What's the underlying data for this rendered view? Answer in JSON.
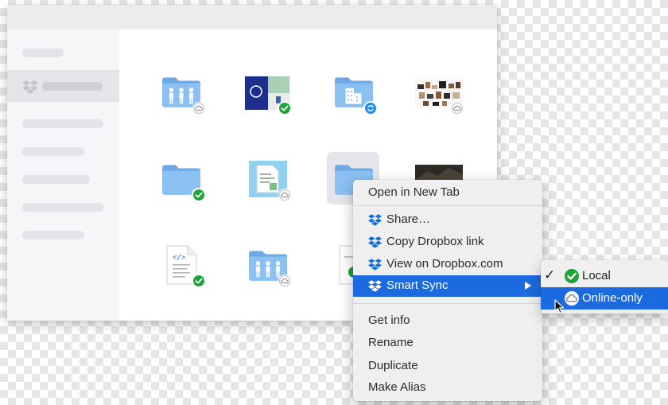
{
  "window": {
    "sidebar_items": 7,
    "selected_item": "dropbox"
  },
  "files": [
    {
      "name": "shared-folder",
      "status": "online-only"
    },
    {
      "name": "image-file",
      "status": "synced"
    },
    {
      "name": "building-folder",
      "status": "syncing"
    },
    {
      "name": "collage-image",
      "status": "online-only"
    },
    {
      "name": "folder",
      "status": "synced"
    },
    {
      "name": "document-image",
      "status": "online-only"
    },
    {
      "name": "selected-folder",
      "status": "selected"
    },
    {
      "name": "dark-photo",
      "status": "online-only"
    },
    {
      "name": "code-document",
      "status": "synced"
    },
    {
      "name": "shared-folder-2",
      "status": "online-only"
    },
    {
      "name": "partial-file",
      "status": "synced"
    }
  ],
  "context_menu": {
    "open_new_tab": "Open in New Tab",
    "share": "Share…",
    "copy_link": "Copy Dropbox link",
    "view_on_web": "View on Dropbox.com",
    "smart_sync": "Smart Sync",
    "get_info": "Get info",
    "rename": "Rename",
    "duplicate": "Duplicate",
    "make_alias": "Make Alias"
  },
  "smart_sync_submenu": {
    "local": "Local",
    "online_only": "Online-only",
    "checked": "local",
    "highlighted": "online-only"
  },
  "colors": {
    "folder": "#7fb8ef",
    "highlight": "#1c6ae0",
    "synced_badge": "#1fa43a",
    "syncing_badge": "#1e89f0",
    "dropbox_blue": "#0d6fe0"
  }
}
